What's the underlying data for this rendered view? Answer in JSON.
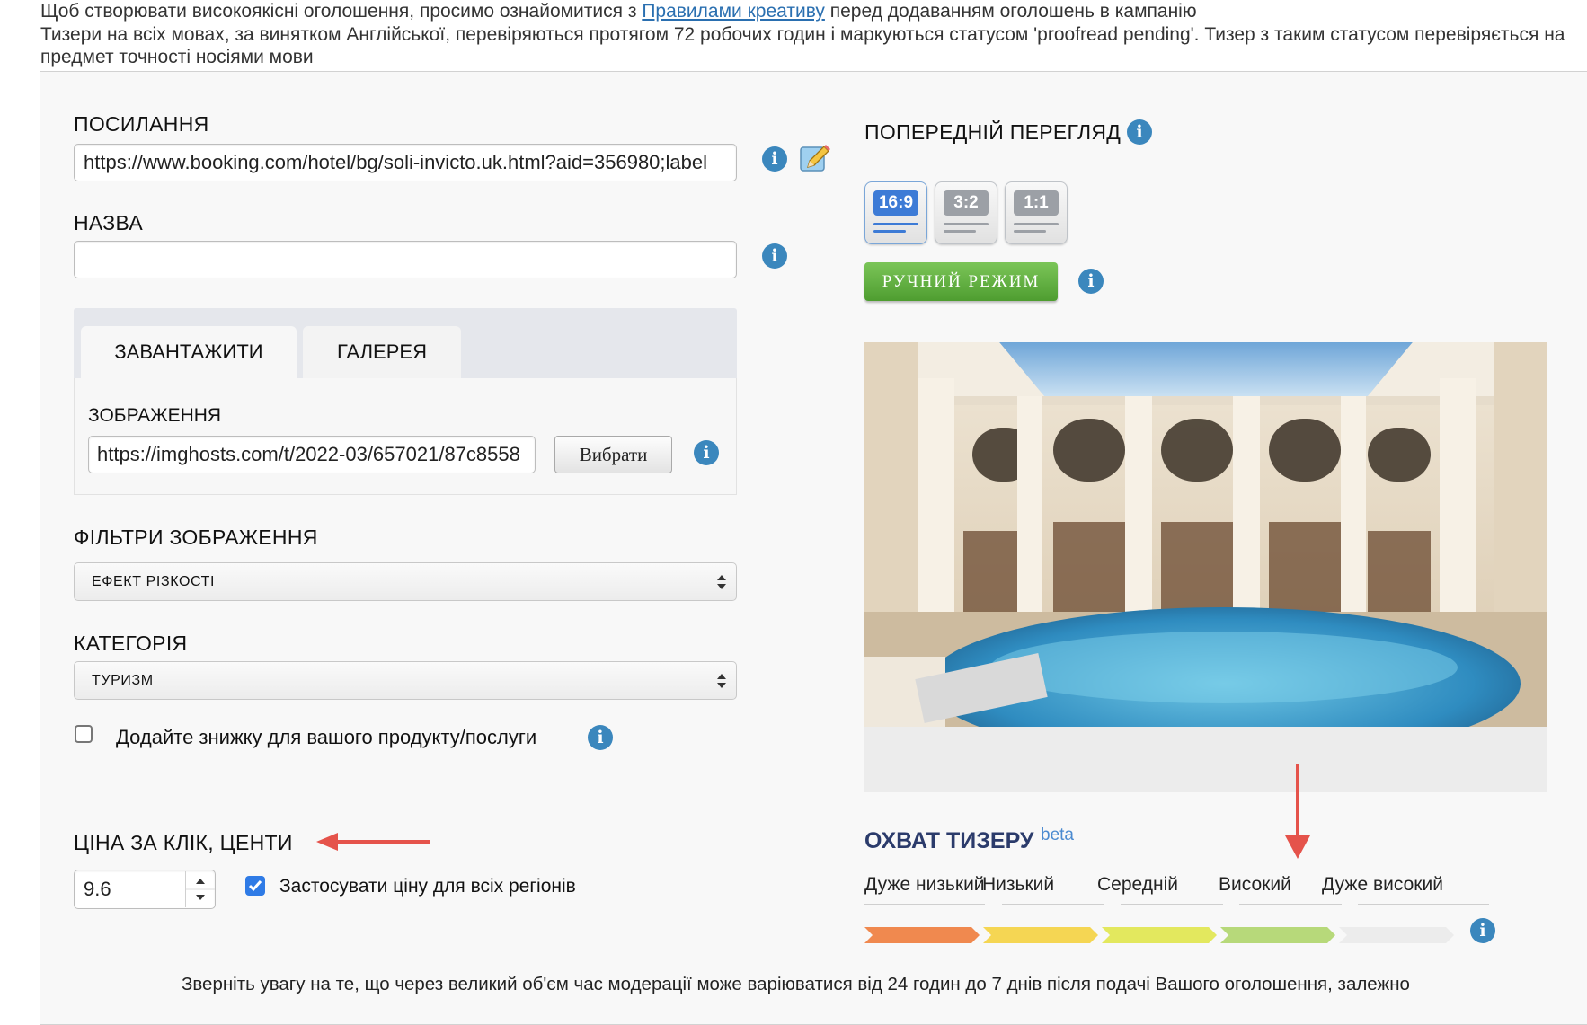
{
  "intro": {
    "line1_pre": "Щоб створювати високоякісні оголошення, просимо ознайомитися з ",
    "line1_link": "Правилами креативу",
    "line1_post": " перед додаванням оголошень в кампанію",
    "line2": "Тизери на всіх мовах, за винятком Англійської, перевіряються протягом 72 робочих годин і маркуються статусом 'proofread pending'. Тизер з таким статусом перевіряється на",
    "line3": "предмет точності носіями мови"
  },
  "form": {
    "link_label": "ПОСИЛАННЯ",
    "link_value": "https://www.booking.com/hotel/bg/soli-invicto.uk.html?aid=356980;label",
    "name_label": "НАЗВА",
    "name_value": "",
    "tabs": [
      "ЗАВАНТАЖИТИ",
      "ГАЛЕРЕЯ"
    ],
    "image_label": "ЗОБРАЖЕННЯ",
    "image_value": "https://imghosts.com/t/2022-03/657021/87c8558",
    "choose_button": "Вибрати",
    "filters_label": "ФІЛЬТРИ ЗОБРАЖЕННЯ",
    "filter_selected": "ЕФЕКТ РІЗКОСТІ",
    "category_label": "КАТЕГОРІЯ",
    "category_selected": "ТУРИЗМ",
    "discount_label": "Додайте знижку для вашого продукту/послуги",
    "discount_checked": false,
    "cpc_label": "ЦІНА ЗА КЛІК, ЦЕНТИ",
    "cpc_value": "9.6",
    "apply_all_label": "Застосувати ціну для всіх регіонів",
    "apply_all_checked": true
  },
  "preview": {
    "title": "ПОПЕРЕДНІЙ ПЕРЕГЛЯД",
    "ratios": [
      "16:9",
      "3:2",
      "1:1"
    ],
    "selected_ratio": "16:9",
    "manual_button": "РУЧНИЙ РЕЖИМ",
    "image_icon": "hotel-pool-image"
  },
  "reach": {
    "title": "ОХВАТ ТИЗЕРУ",
    "beta": "beta",
    "levels": [
      "Дуже низький",
      "Низький",
      "Середній",
      "Високий",
      "Дуже високий"
    ],
    "current_level": "Високий",
    "segment_colors": [
      "#f0894f",
      "#f5d653",
      "#e3e85e",
      "#b7d97a",
      "#ececec"
    ]
  },
  "note": "Зверніть увагу на те, що через великий об'єм час модерації може варіюватися від 24 годин до 7 днів після подачі Вашого оголошення, залежно",
  "colors": {
    "accent_blue": "#3b87bd",
    "manual_green": "#5aaa3a",
    "annotation_red": "#e5534b"
  },
  "icons": {
    "info": "i",
    "edit": "pencil-icon"
  }
}
